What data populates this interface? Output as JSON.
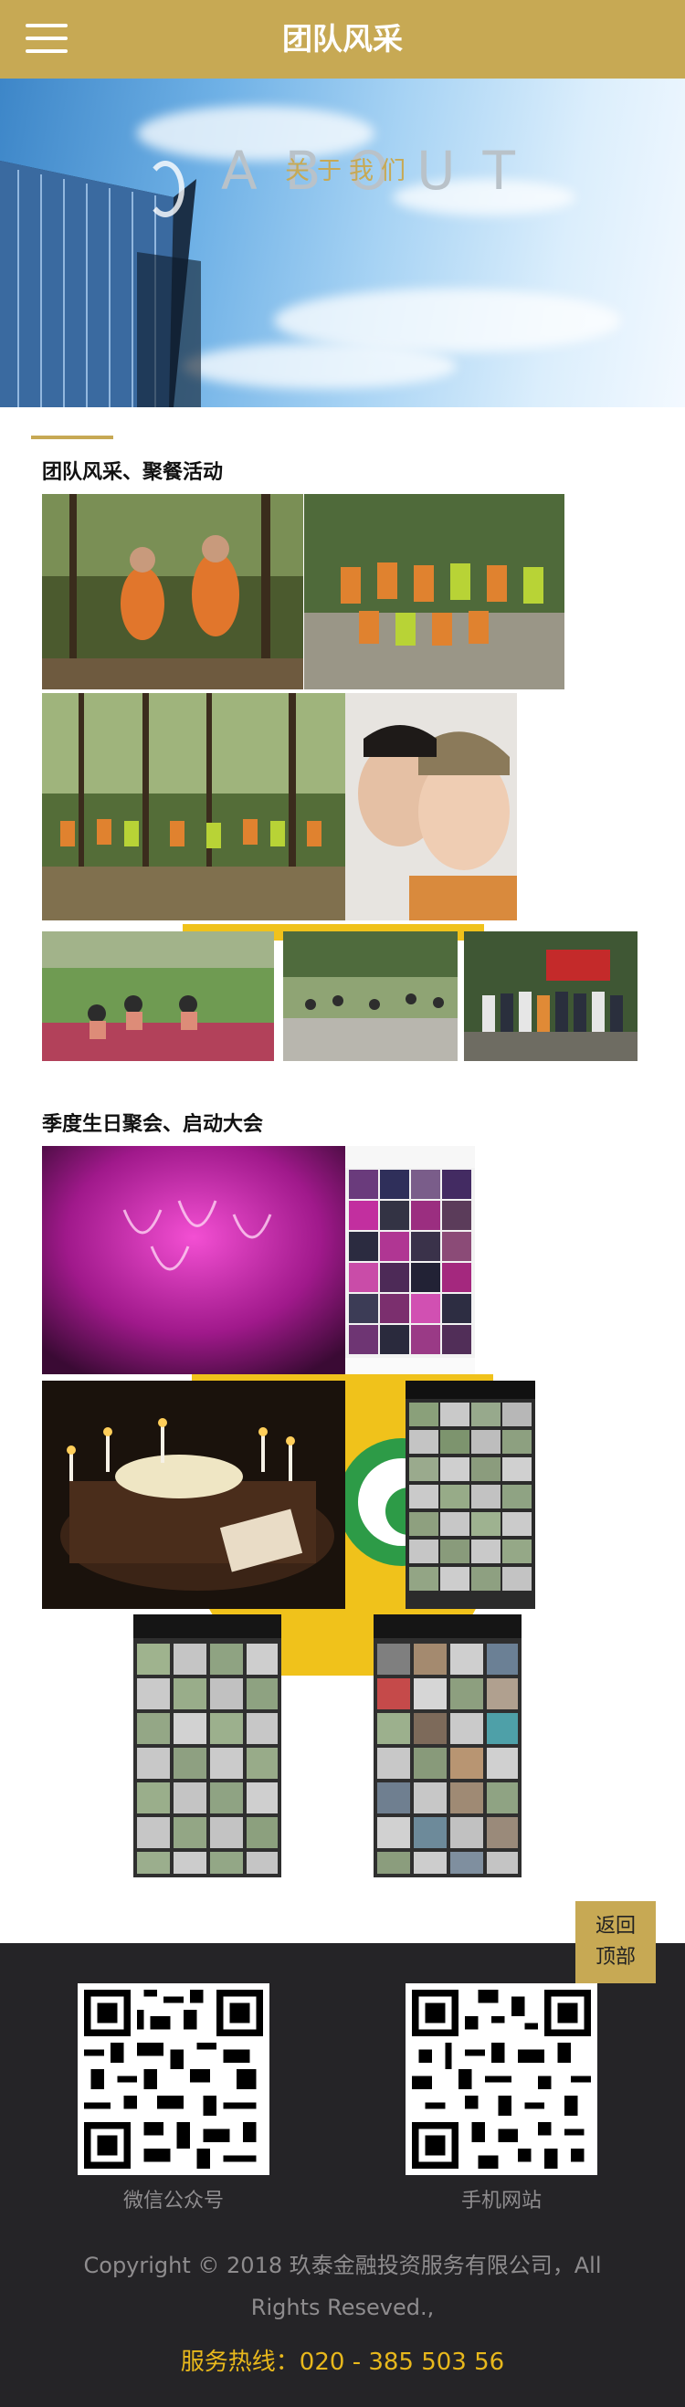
{
  "header": {
    "title": "团队风采"
  },
  "banner": {
    "title_en": "ABOUT",
    "title_cn": "关于我们"
  },
  "sections": [
    {
      "title": "团队风采、聚餐活动"
    },
    {
      "title": "季度生日聚会、启动大会"
    }
  ],
  "back_to_top": {
    "line1": "返回",
    "line2": "顶部"
  },
  "footer": {
    "qr_wechat_label": "微信公众号",
    "qr_mobile_label": "手机网站",
    "copyright_line1": "Copyright © 2018 玖泰金融投资服务有限公司，All",
    "copyright_line2": "Rights Reseved.,",
    "hotline": "服务热线：020 - 385 503 56"
  },
  "colors": {
    "brand_gold": "#c7a954",
    "footer_bg": "#252427",
    "hotline": "#e8b81c"
  }
}
